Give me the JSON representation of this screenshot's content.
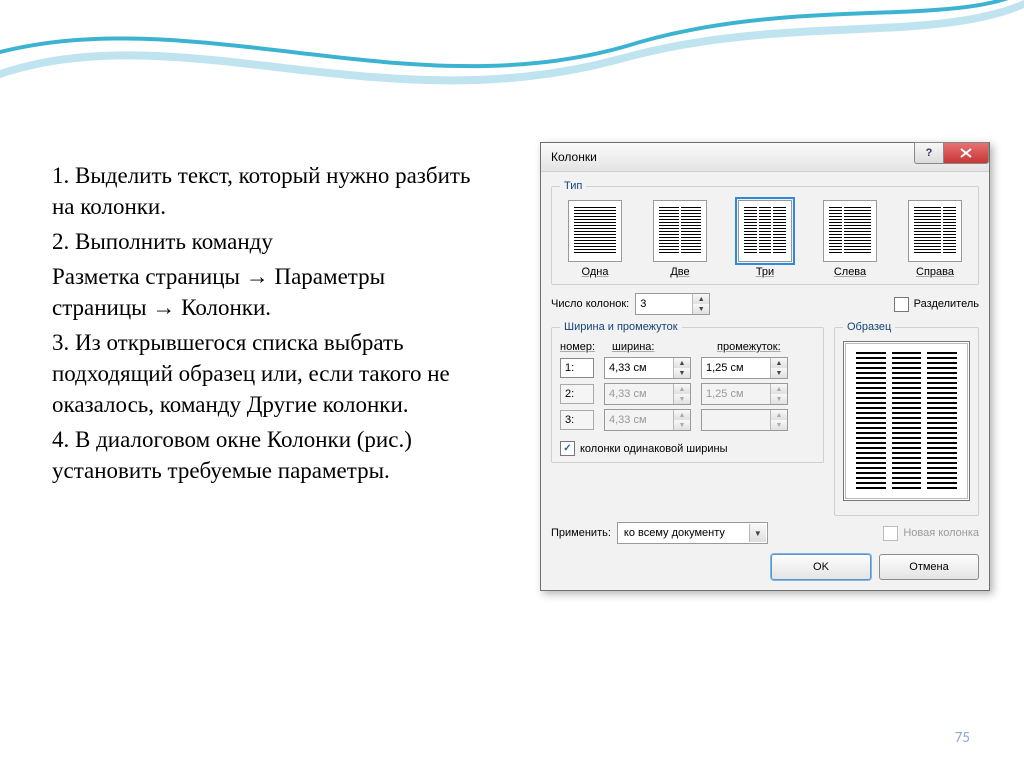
{
  "page_number": "75",
  "instructions": {
    "p1": "1. Выделить текст, который нужно разбить на колонки.",
    "p2": "2. Выполнить команду",
    "p3": "Разметка страницы → Параметры страницы → Колонки.",
    "p4": "3. Из открывшегося списка выбрать подходящий образец или, если такого не оказалось, команду Другие колонки.",
    "p5": "4. В диалоговом окне Колонки (рис.) установить требуемые параметры."
  },
  "dialog": {
    "title": "Колонки",
    "help_label": "?",
    "type_group": "Тип",
    "types": {
      "one": "Одна",
      "two": "Две",
      "three": "Три",
      "left": "Слева",
      "right": "Справа"
    },
    "count_label": "Число колонок:",
    "count_value": "3",
    "separator_label": "Разделитель",
    "wg_group": "Ширина и промежуток",
    "preview_group": "Образец",
    "wg_headers": {
      "num": "номер:",
      "width": "ширина:",
      "gap": "промежуток:"
    },
    "rows": [
      {
        "num": "1:",
        "width": "4,33 см",
        "gap": "1,25 см",
        "enabled": true
      },
      {
        "num": "2:",
        "width": "4,33 см",
        "gap": "1,25 см",
        "enabled": false
      },
      {
        "num": "3:",
        "width": "4,33 см",
        "gap": "",
        "enabled": false
      }
    ],
    "equal_width_label": "колонки одинаковой ширины",
    "apply_label": "Применить:",
    "apply_value": "ко всему документу",
    "new_column_label": "Новая колонка",
    "ok": "OK",
    "cancel": "Отмена"
  }
}
